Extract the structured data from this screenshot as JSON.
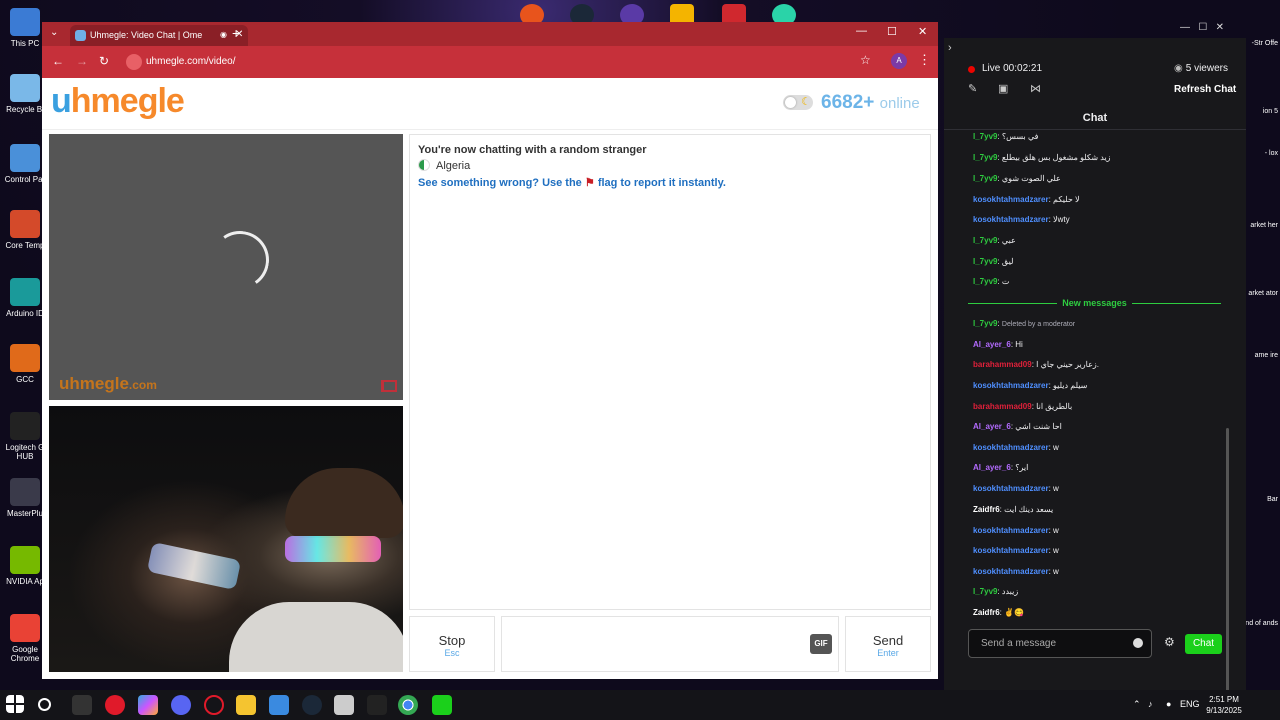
{
  "desktop": {
    "icons": [
      {
        "label": "This PC",
        "color": "#3b7bd4"
      },
      {
        "label": "Recycle Bi",
        "color": "#7ab8e8"
      },
      {
        "label": "Control Par",
        "color": "#4a90d9"
      },
      {
        "label": "Core Temp",
        "color": "#d44a2a"
      },
      {
        "label": "Arduino ID",
        "color": "#1a9a9a"
      },
      {
        "label": "GCC",
        "color": "#e06a1a"
      },
      {
        "label": "Logitech G HUB",
        "color": "#222222"
      },
      {
        "label": "MasterPlu",
        "color": "#3a3a4a"
      },
      {
        "label": "NVIDIA Ap",
        "color": "#76b900"
      },
      {
        "label": "Google Chrome",
        "color": "#e94235"
      }
    ],
    "right_labels": [
      "-Str Offe",
      "ion 5",
      "- lox",
      "arket her",
      "arket ator",
      "ame ire",
      "Bar",
      "nd of ands"
    ]
  },
  "browser": {
    "tab_title": "Uhmegle: Video Chat | Ome",
    "url": "uhmegle.com/video/",
    "profile_initial": "A"
  },
  "site": {
    "logo_u": "u",
    "logo_rest": "hmegle",
    "online_count": "6682+",
    "online_label": "online",
    "watermark": "uhmegle",
    "watermark_suffix": ".com",
    "status_line": "You're now chatting with a random stranger",
    "country": "Algeria",
    "report_before": "See something wrong? Use the",
    "report_after": "flag to report it instantly.",
    "stop_label": "Stop",
    "stop_hint": "Esc",
    "send_label": "Send",
    "send_hint": "Enter",
    "gif_label": "GIF"
  },
  "stream": {
    "live_label": "Live 00:02:21",
    "viewers": "5 viewers",
    "refresh_label": "Refresh Chat",
    "chat_title": "Chat",
    "new_messages_label": "New messages",
    "input_placeholder": "Send a message",
    "chat_button": "Chat",
    "messages": [
      {
        "user": "l_7yv9",
        "color": "#2ecc40",
        "text": "في بسس؟"
      },
      {
        "user": "l_7yv9",
        "color": "#2ecc40",
        "text": "زيد شكلو مشغول بس هلق بيطلع"
      },
      {
        "user": "l_7yv9",
        "color": "#2ecc40",
        "text": "علي الصوت شوي"
      },
      {
        "user": "kosokhtahmadzarer",
        "color": "#4f8fff",
        "text": "لا حليكم"
      },
      {
        "user": "kosokhtahmadzarer",
        "color": "#4f8fff",
        "text": "لاwty"
      },
      {
        "user": "l_7yv9",
        "color": "#2ecc40",
        "text": "عبي"
      },
      {
        "user": "l_7yv9",
        "color": "#2ecc40",
        "text": "ليق"
      },
      {
        "user": "l_7yv9",
        "color": "#2ecc40",
        "text": "ت"
      },
      {
        "user": "l_7yv9",
        "color": "#2ecc40",
        "text": "Deleted by a moderator",
        "system": true
      },
      {
        "user": "Al_ayer_6",
        "color": "#b36bff",
        "text": "Hi"
      },
      {
        "user": "barahammad09",
        "color": "#e0203a",
        "text": "زعارير حيني جاي ا."
      },
      {
        "user": "kosokhtahmadzarer",
        "color": "#4f8fff",
        "text": "سيلم ديليو"
      },
      {
        "user": "barahammad09",
        "color": "#e0203a",
        "text": "بالطريق انا"
      },
      {
        "user": "Al_ayer_6",
        "color": "#b36bff",
        "text": "احا شنت اشي"
      },
      {
        "user": "kosokhtahmadzarer",
        "color": "#4f8fff",
        "text": "w"
      },
      {
        "user": "Al_ayer_6",
        "color": "#b36bff",
        "text": "اير؟"
      },
      {
        "user": "kosokhtahmadzarer",
        "color": "#4f8fff",
        "text": "w"
      },
      {
        "user": "Zaidfr6",
        "color": "#ffffff",
        "text": "يسعد دينك ايت"
      },
      {
        "user": "kosokhtahmadzarer",
        "color": "#4f8fff",
        "text": "w"
      },
      {
        "user": "kosokhtahmadzarer",
        "color": "#4f8fff",
        "text": "w"
      },
      {
        "user": "kosokhtahmadzarer",
        "color": "#4f8fff",
        "text": "w"
      },
      {
        "user": "l_7yv9",
        "color": "#2ecc40",
        "text": "زيبدد"
      },
      {
        "user": "Zaidfr6",
        "color": "#ffffff",
        "text": "✌️😋"
      }
    ]
  },
  "taskbar": {
    "lang": "ENG",
    "time": "2:51 PM",
    "date": "9/13/2025"
  }
}
